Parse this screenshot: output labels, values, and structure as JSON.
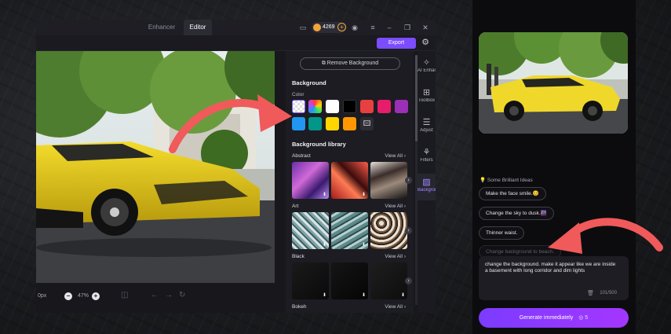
{
  "editor": {
    "tabs": [
      {
        "label": "Enhancer"
      },
      {
        "label": "Editor"
      }
    ],
    "credits": "4269",
    "export_label": "Export",
    "bottombar": {
      "px_label": "0px",
      "zoom": "47%"
    }
  },
  "panel": {
    "remove_bg_label": "Remove Background",
    "background_title": "Background",
    "color_label": "Color",
    "library_title": "Background library",
    "view_all": "View All",
    "categories": [
      {
        "name": "Abstract"
      },
      {
        "name": "Art"
      },
      {
        "name": "Black"
      },
      {
        "name": "Bokeh"
      }
    ],
    "swatch_colors": [
      "#ffffff",
      "#000000",
      "#e84040",
      "#e61d6b",
      "#9b2fb5",
      "#2196f3",
      "#009688",
      "#ffd600",
      "#ff9800"
    ]
  },
  "rail": {
    "items": [
      {
        "label": "AI Enhance"
      },
      {
        "label": "ToolBox"
      },
      {
        "label": "Adjust"
      },
      {
        "label": "Filters"
      },
      {
        "label": "Background"
      }
    ]
  },
  "chat": {
    "ideas_title": "Some Brilliant Ideas",
    "suggestions": [
      {
        "label": "Make the face smile.😊"
      },
      {
        "label": "Change the sky to dusk.🌆"
      },
      {
        "label": "Thinner waist."
      },
      {
        "label": "Change background to beach."
      }
    ],
    "prompt_text": "change the background. make it appear like we are inside a basement with long corridor and dim lights",
    "char_count": "101/500",
    "generate_label": "Generate immediately",
    "generate_cost": "5"
  },
  "colors": {
    "accent": "#7b4dff",
    "arrow": "#f05a5a",
    "coin": "#f1a33a"
  }
}
